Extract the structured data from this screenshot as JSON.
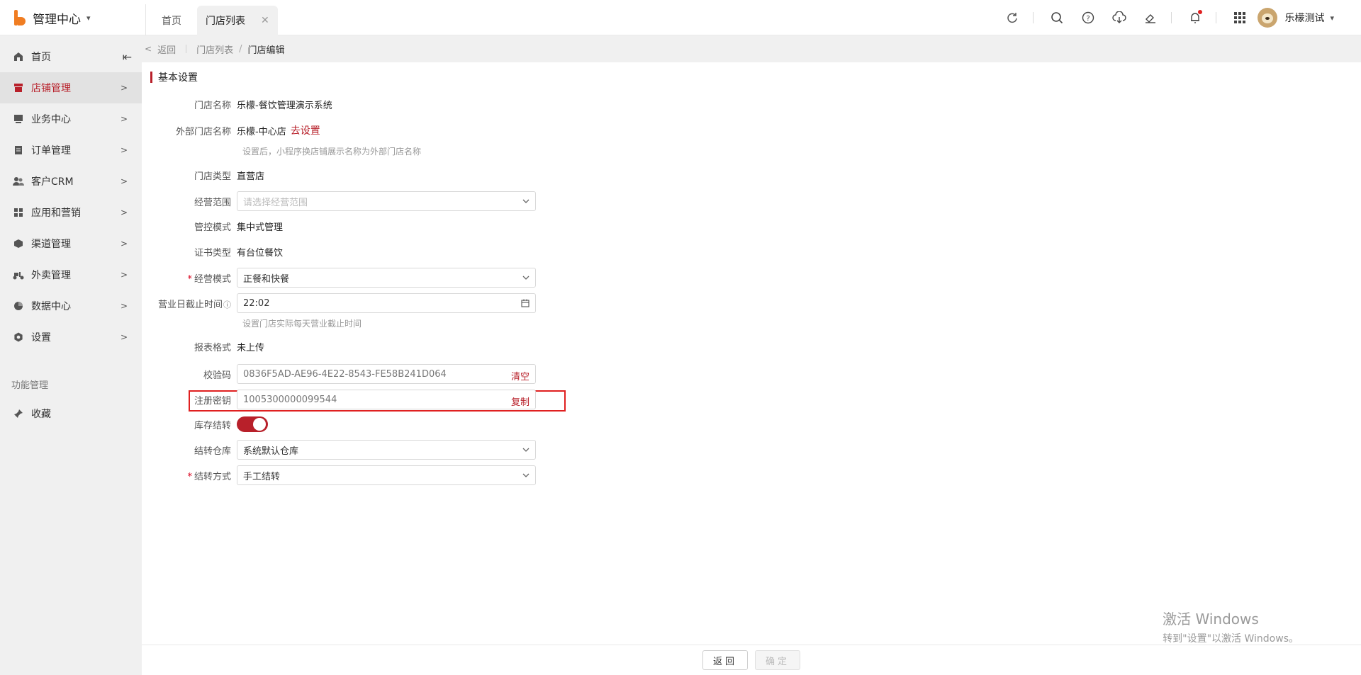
{
  "header": {
    "app_title": "管理中心",
    "tabs": [
      {
        "label": "首页"
      },
      {
        "label": "门店列表"
      }
    ],
    "username": "乐檬测试"
  },
  "sidebar": {
    "items": [
      {
        "label": "首页"
      },
      {
        "label": "店铺管理"
      },
      {
        "label": "业务中心"
      },
      {
        "label": "订单管理"
      },
      {
        "label": "客户CRM"
      },
      {
        "label": "应用和营销"
      },
      {
        "label": "渠道管理"
      },
      {
        "label": "外卖管理"
      },
      {
        "label": "数据中心"
      },
      {
        "label": "设置"
      }
    ],
    "group_label": "功能管理",
    "favorites_label": "收藏"
  },
  "breadcrumb": {
    "back": "返回",
    "parent": "门店列表",
    "sep": "/",
    "current": "门店编辑"
  },
  "form": {
    "section_title": "基本设置",
    "store_name": {
      "label": "门店名称",
      "value": "乐檬-餐饮管理演示系统"
    },
    "external_name": {
      "label": "外部门店名称",
      "value": "乐檬-中心店",
      "link": "去设置",
      "hint": "设置后，小程序换店铺展示名称为外部门店名称"
    },
    "store_type": {
      "label": "门店类型",
      "value": "直营店"
    },
    "business_scope": {
      "label": "经营范围",
      "placeholder": "请选择经营范围"
    },
    "control_mode": {
      "label": "管控模式",
      "value": "集中式管理"
    },
    "cert_type": {
      "label": "证书类型",
      "value": "有台位餐饮"
    },
    "business_mode": {
      "label": "经营模式",
      "value": "正餐和快餐"
    },
    "cutoff_time": {
      "label": "营业日截止时间",
      "value": "22:02",
      "hint": "设置门店实际每天营业截止时间"
    },
    "report_format": {
      "label": "报表格式",
      "value": "未上传"
    },
    "checksum": {
      "label": "校验码",
      "value": "0836F5AD-AE96-4E22-8543-FE58B241D064",
      "action": "清空"
    },
    "reg_key": {
      "label": "注册密钥",
      "value": "1005300000099544",
      "action": "复制"
    },
    "stock_carry": {
      "label": "库存结转",
      "enabled": true
    },
    "carry_warehouse": {
      "label": "结转仓库",
      "value": "系统默认仓库"
    },
    "carry_method": {
      "label": "结转方式",
      "value": "手工结转"
    }
  },
  "footer": {
    "back_button": "返回",
    "confirm_button": "确定"
  },
  "windows_watermark": {
    "line1": "激活 Windows",
    "line2": "转到\"设置\"以激活 Windows。"
  },
  "colors": {
    "accent": "#b8202a",
    "brand": "#f07d22",
    "highlight": "#e02020"
  }
}
